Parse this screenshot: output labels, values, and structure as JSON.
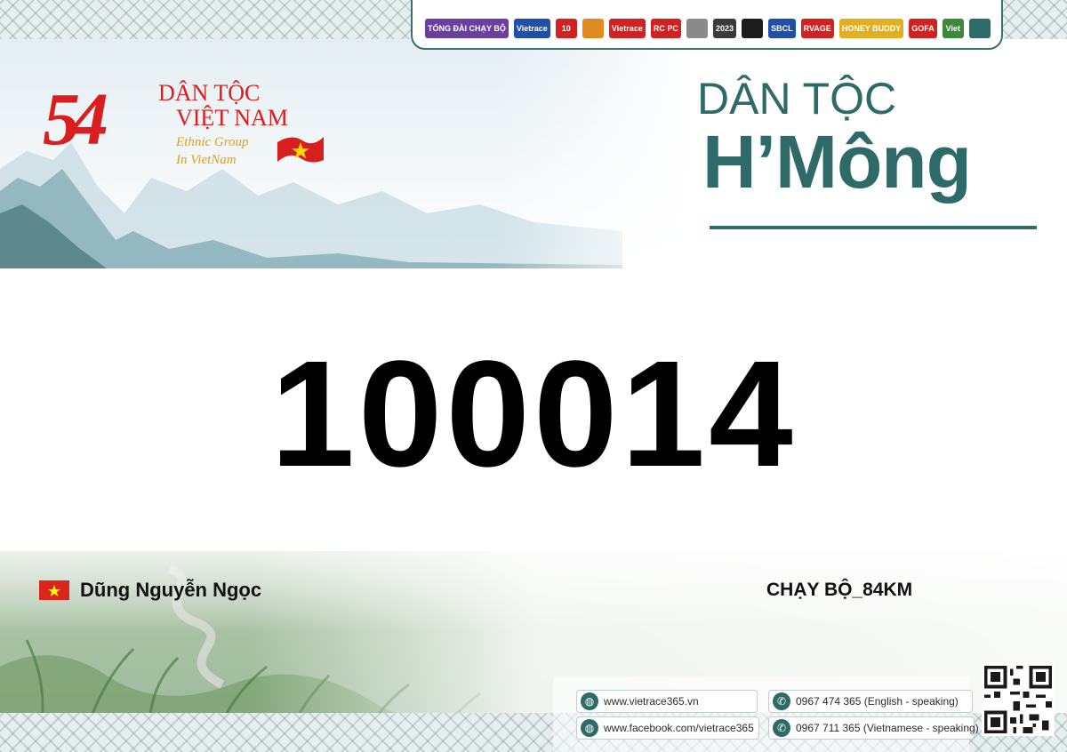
{
  "sponsors": [
    {
      "name": "TỔNG ĐÀI CHẠY BỘ",
      "color": "#6a3fa0"
    },
    {
      "name": "Vietrace",
      "color": "#1f4fa8"
    },
    {
      "name": "10",
      "color": "#d32020"
    },
    {
      "name": "",
      "color": "#e08a20"
    },
    {
      "name": "Vietrace",
      "color": "#d32020"
    },
    {
      "name": "RC PC",
      "color": "#d32020"
    },
    {
      "name": "",
      "color": "#8a8a8a"
    },
    {
      "name": "2023",
      "color": "#3a3a3a"
    },
    {
      "name": "",
      "color": "#1c1c1c"
    },
    {
      "name": "SBCL",
      "color": "#1f4fa8"
    },
    {
      "name": "RVAGE",
      "color": "#d32020"
    },
    {
      "name": "HONEY BUDDY",
      "color": "#e0b020"
    },
    {
      "name": "GOFA",
      "color": "#d32020"
    },
    {
      "name": "Viet",
      "color": "#3a8a3a"
    },
    {
      "name": "",
      "color": "#2d6a68"
    }
  ],
  "logo": {
    "number": "54",
    "line1": "DÂN TỘC",
    "line2": "VIỆT NAM",
    "english1": "Ethnic Group",
    "english2": "In VietNam"
  },
  "group": {
    "prefix": "DÂN TỘC",
    "name": "H’Mông"
  },
  "bib": {
    "number": "100014"
  },
  "runner": {
    "name": "Dũng Nguyễn Ngọc",
    "category": "CHẠY BỘ_84KM"
  },
  "contact": {
    "website": "www.vietrace365.vn",
    "facebook": "www.facebook.com/vietrace365",
    "phone_en": "0967 474 365 (English - speaking)",
    "phone_vi": "0967 711 365 (Vietnamese - speaking)"
  },
  "colors": {
    "brand_teal": "#2d6a68",
    "logo_red": "#d81e1e",
    "logo_gold": "#e0a018"
  }
}
